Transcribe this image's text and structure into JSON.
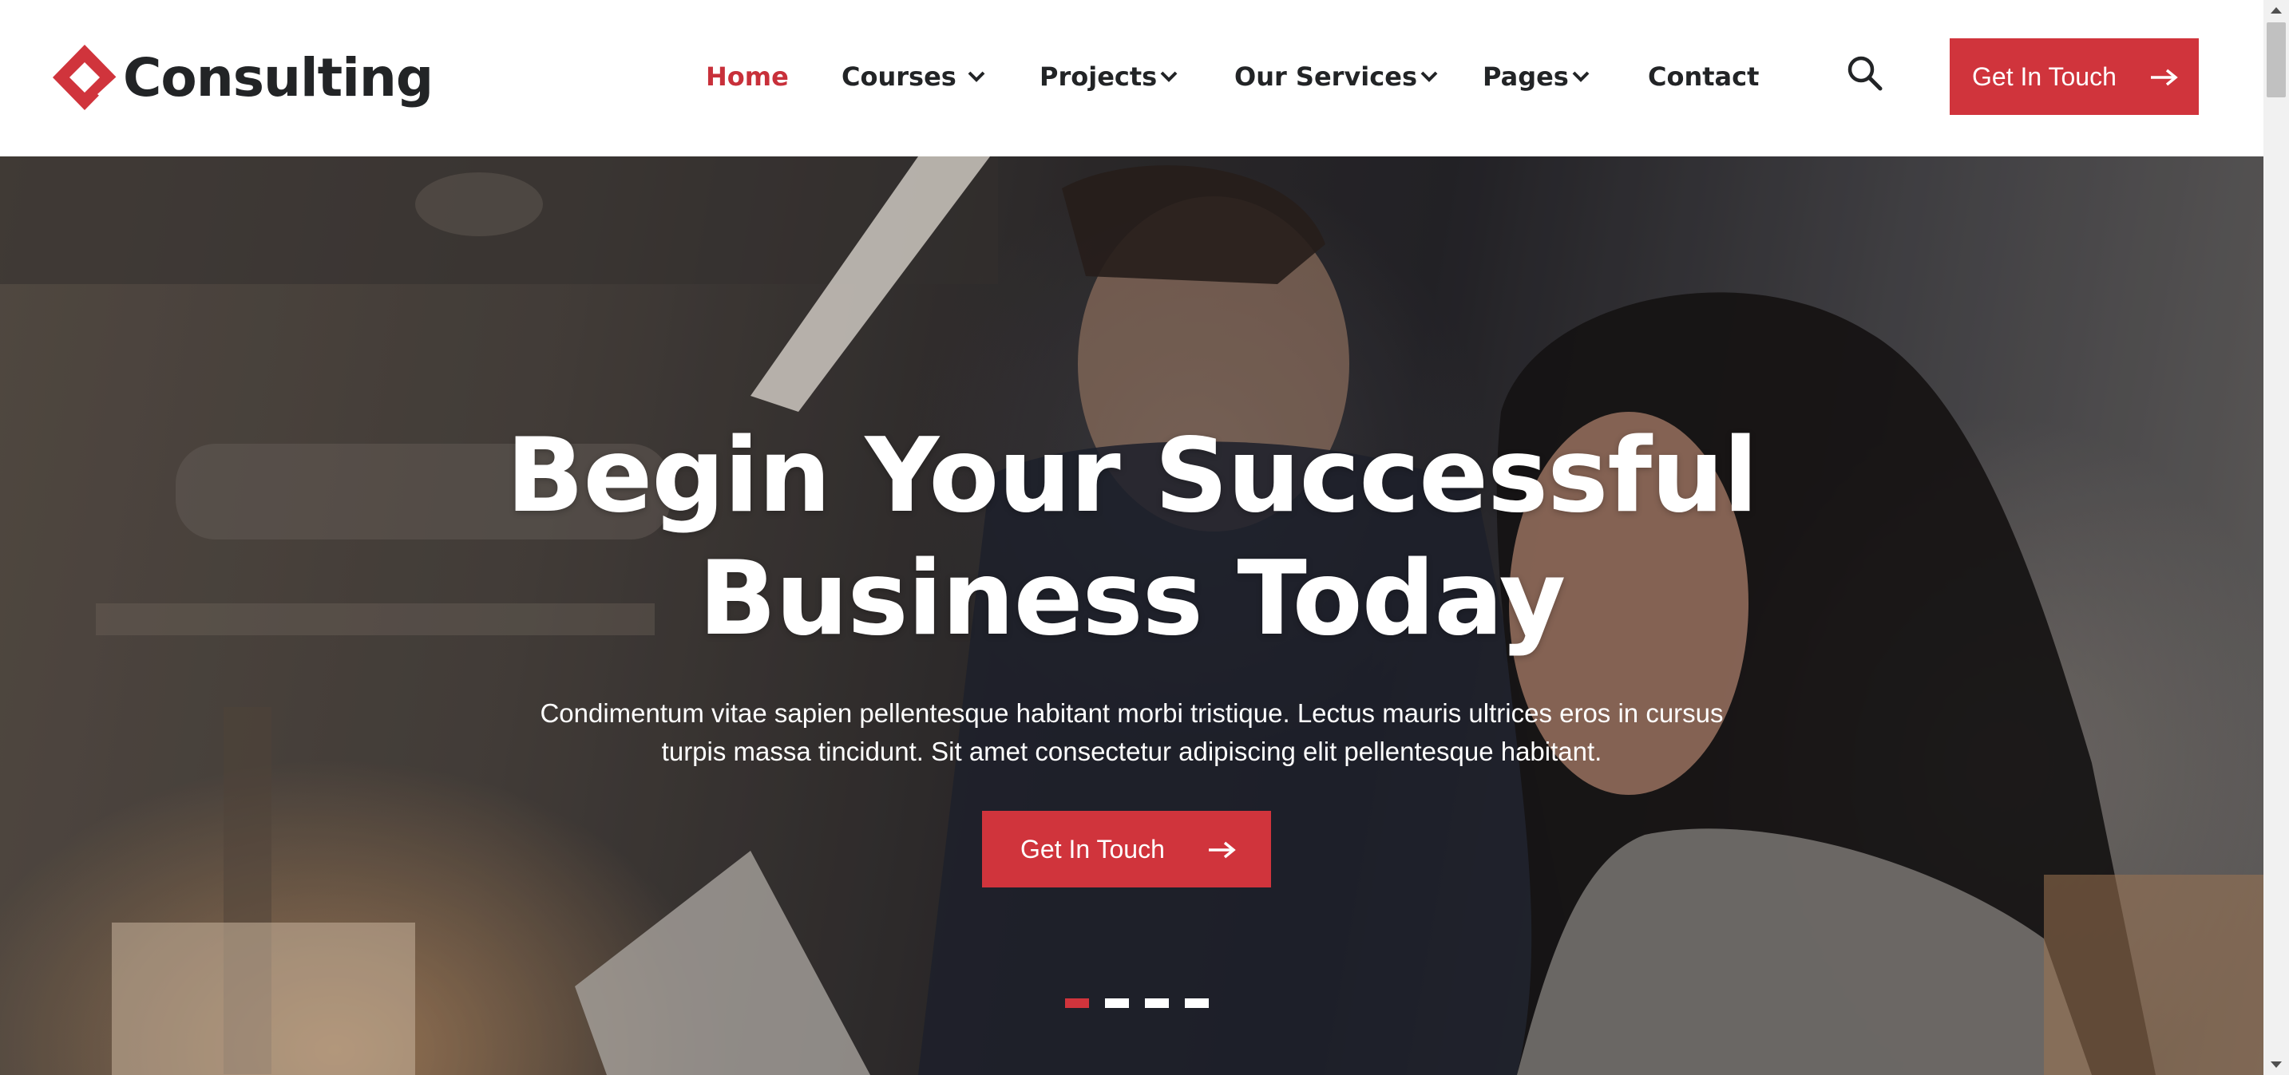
{
  "brand": {
    "name": "Consulting",
    "accent_color": "#d0343c",
    "logo_icon": "diamond-logo-icon"
  },
  "nav": {
    "items": [
      {
        "label": "Home",
        "active": true,
        "has_dropdown": false
      },
      {
        "label": "Courses",
        "active": false,
        "has_dropdown": true
      },
      {
        "label": "Projects",
        "active": false,
        "has_dropdown": true
      },
      {
        "label": "Our Services",
        "active": false,
        "has_dropdown": true
      },
      {
        "label": "Pages",
        "active": false,
        "has_dropdown": true
      },
      {
        "label": "Contact",
        "active": false,
        "has_dropdown": false
      }
    ],
    "search_icon": "search-icon",
    "cta_label": "Get In Touch",
    "cta_icon": "arrow-right-icon"
  },
  "hero": {
    "title_line1": "Begin Your Successful",
    "title_line2": "Business Today",
    "text_line1": "Condimentum vitae sapien pellentesque habitant morbi tristique. Lectus mauris ultrices eros in cursus",
    "text_line2": "turpis massa tincidunt. Sit amet consectetur adipiscing elit pellentesque habitant.",
    "cta_label": "Get In Touch",
    "cta_icon": "arrow-right-icon",
    "slides_total": 4,
    "active_slide": 1
  },
  "colors": {
    "active_nav": "#c8303a",
    "text": "#222426",
    "button": "#d0343c"
  }
}
